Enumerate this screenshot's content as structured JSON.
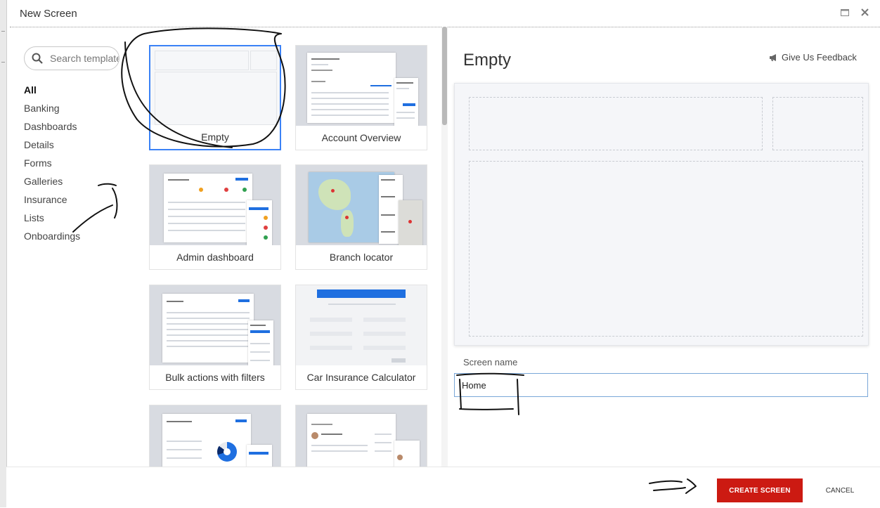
{
  "window": {
    "title": "New Screen"
  },
  "search": {
    "placeholder": "Search templates"
  },
  "categories": [
    "All",
    "Banking",
    "Dashboards",
    "Details",
    "Forms",
    "Galleries",
    "Insurance",
    "Lists",
    "Onboardings"
  ],
  "templates": [
    {
      "label": "Empty"
    },
    {
      "label": "Account Overview"
    },
    {
      "label": "Admin dashboard"
    },
    {
      "label": "Branch locator"
    },
    {
      "label": "Bulk actions with filters"
    },
    {
      "label": "Car Insurance Calculator"
    }
  ],
  "preview": {
    "title": "Empty",
    "feedback_label": "Give Us Feedback"
  },
  "form": {
    "screen_name_label": "Screen name",
    "screen_name_value": "Home"
  },
  "footer": {
    "create_label": "CREATE SCREEN",
    "cancel_label": "CANCEL"
  },
  "colors": {
    "accent": "#3b82f6",
    "primary_button": "#cc1a12"
  }
}
